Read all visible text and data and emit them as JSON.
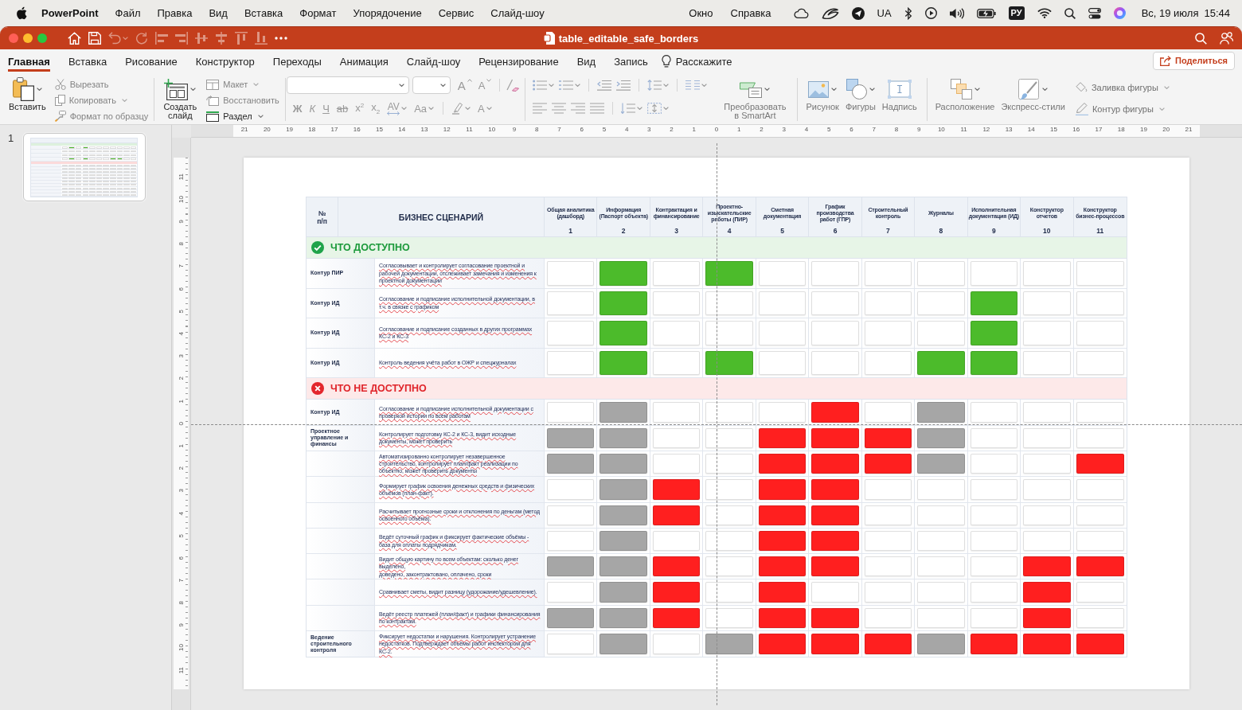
{
  "menu_bar": {
    "app": "PowerPoint",
    "menus": [
      "Файл",
      "Правка",
      "Вид",
      "Вставка",
      "Формат",
      "Упорядочение",
      "Сервис",
      "Слайд-шоу"
    ],
    "window_menus": [
      "Окно",
      "Справка"
    ],
    "region": "UA",
    "input_source": "РУ",
    "date": "Вс, 19 июля",
    "time": "15:44"
  },
  "window": {
    "title": "table_editable_safe_borders",
    "quick_access": [
      {
        "disabled": false
      },
      {
        "disabled": false
      },
      {
        "disabled": true
      },
      {
        "disabled": true
      },
      {
        "disabled": true
      },
      {
        "disabled": true
      },
      {
        "disabled": true
      },
      {
        "disabled": true
      },
      {
        "disabled": true
      },
      {
        "disabled": true
      },
      {
        "disabled": false
      }
    ]
  },
  "ribbon": {
    "tabs": [
      {
        "label": "Главная",
        "selected": true
      },
      {
        "label": "Вставка",
        "selected": false
      },
      {
        "label": "Рисование",
        "selected": false
      },
      {
        "label": "Конструктор",
        "selected": false
      },
      {
        "label": "Переходы",
        "selected": false
      },
      {
        "label": "Анимация",
        "selected": false
      },
      {
        "label": "Слайд-шоу",
        "selected": false
      },
      {
        "label": "Рецензирование",
        "selected": false
      },
      {
        "label": "Вид",
        "selected": false
      },
      {
        "label": "Запись",
        "selected": false
      }
    ],
    "tell_me": "Расскажите",
    "share": "Поделиться",
    "groups": [
      {
        "kind": "clipboard",
        "large": [
          {
            "label": "Вставить",
            "disabled": false,
            "dropdown": true
          }
        ],
        "small": [
          {
            "label": "Вырезать",
            "disabled": true,
            "dropdown": false
          },
          {
            "label": "Копировать",
            "disabled": true,
            "dropdown": true
          },
          {
            "label": "Формат по образцу",
            "disabled": true,
            "dropdown": false
          }
        ]
      },
      {
        "kind": "slides",
        "large": [
          {
            "label": "Создать слайд",
            "disabled": false,
            "dropdown": true
          }
        ],
        "small": [
          {
            "label": "Макет",
            "disabled": true,
            "dropdown": true
          },
          {
            "label": "Восстановить",
            "disabled": true,
            "dropdown": false
          },
          {
            "label": "Раздел",
            "disabled": false,
            "dropdown": true
          }
        ]
      },
      {
        "kind": "font",
        "buttons": [
          {
            "kind": "grow",
            "glyph": "A",
            "disabled": true,
            "dropdown": false
          },
          {
            "kind": "shrink",
            "glyph": "A",
            "disabled": true,
            "dropdown": false
          },
          {
            "kind": "bold",
            "glyph": "Ж",
            "disabled": true,
            "dropdown": false
          },
          {
            "kind": "italic",
            "glyph": "К",
            "disabled": true,
            "dropdown": false
          },
          {
            "kind": "underline",
            "glyph": "Ч",
            "disabled": true,
            "dropdown": false
          },
          {
            "kind": "strike",
            "glyph": "ab",
            "disabled": true,
            "dropdown": false
          },
          {
            "kind": "superscript",
            "glyph": "x$^{2}$",
            "disabled": true,
            "dropdown": false
          },
          {
            "kind": "subscript",
            "glyph": "x$_{2}$",
            "disabled": true,
            "dropdown": false
          },
          {
            "kind": "spacing",
            "glyph": "AV",
            "disabled": true,
            "dropdown": true
          },
          {
            "kind": "case",
            "glyph": "Aa",
            "disabled": true,
            "dropdown": true
          },
          {
            "kind": "color",
            "glyph": "A",
            "disabled": true,
            "dropdown": true
          }
        ]
      },
      {
        "kind": "paragraph",
        "large": [
          {
            "label": "Преобразовать в SmartArt",
            "disabled": true,
            "dropdown": true
          }
        ]
      },
      {
        "kind": "insert",
        "large": [
          {
            "label": "Рисунок",
            "disabled": true,
            "dropdown": true
          },
          {
            "label": "Фигуры",
            "disabled": true,
            "dropdown": true
          },
          {
            "label": "Надпись",
            "disabled": true,
            "dropdown": false
          }
        ]
      },
      {
        "kind": "drawing",
        "large": [
          {
            "label": "Расположение",
            "disabled": true,
            "dropdown": true
          },
          {
            "label": "Экспресс-стили",
            "disabled": true,
            "dropdown": true
          }
        ],
        "small": [
          {
            "label": "Заливка фигуры",
            "disabled": true,
            "dropdown": true
          },
          {
            "label": "Контур фигуры",
            "disabled": true,
            "dropdown": true
          }
        ]
      }
    ]
  },
  "slide_panel": {
    "slides": [
      {
        "number": "1"
      }
    ]
  },
  "rulers": {
    "horizontal": [
      "21",
      "20",
      "19",
      "18",
      "17",
      "16",
      "15",
      "14",
      "13",
      "12",
      "11",
      "10",
      "9",
      "8",
      "7",
      "6",
      "5",
      "4",
      "3",
      "2",
      "1",
      "0",
      "1",
      "2",
      "3",
      "4",
      "5",
      "6",
      "7",
      "8",
      "9",
      "10",
      "11",
      "12",
      "13",
      "14",
      "15",
      "16",
      "17",
      "18",
      "19",
      "20",
      "21"
    ],
    "vertical": [
      "11",
      "10",
      "9",
      "8",
      "7",
      "6",
      "5",
      "4",
      "3",
      "2",
      "1",
      "0",
      "1",
      "2",
      "3",
      "4",
      "5",
      "6",
      "7",
      "8",
      "9",
      "10",
      "11"
    ]
  },
  "slide": {
    "table": {
      "number_heading": "№ п/п",
      "scenario_heading": "БИЗНЕС СЦЕНАРИЙ",
      "columns": [
        {
          "title": "Общая аналитика (дашборд)",
          "number": "1"
        },
        {
          "title": "Информация (Паспорт объекта)",
          "number": "2"
        },
        {
          "title": "Контрактация и финансирование",
          "number": "3"
        },
        {
          "title": "Проектно-изыскательские работы (ПИР)",
          "number": "4"
        },
        {
          "title": "Сметная документация",
          "number": "5"
        },
        {
          "title": "График производства работ (ГПР)",
          "number": "6"
        },
        {
          "title": "Строительный контроль",
          "number": "7"
        },
        {
          "title": "Журналы",
          "number": "8"
        },
        {
          "title": "Исполнительная документация (ИД)",
          "number": "9"
        },
        {
          "title": "Конструктор отчетов",
          "number": "10"
        },
        {
          "title": "Конструктор бизнес-процессов",
          "number": "11"
        }
      ],
      "sections": [
        {
          "kind": "available",
          "title": "ЧТО ДОСТУПНО",
          "rows": [
            {
              "label": "Контур ПИР",
              "text": "Согласовывает и контролирует согласование проектной и рабочей документации, отслеживает замечания и изменения к проектной документации",
              "cells": [
                {
                  "color": "#ffffff"
                },
                {
                  "color": "#4cbb2b"
                },
                {
                  "color": "#ffffff"
                },
                {
                  "color": "#4cbb2b"
                },
                {
                  "color": "#ffffff"
                },
                {
                  "color": "#ffffff"
                },
                {
                  "color": "#ffffff"
                },
                {
                  "color": "#ffffff"
                },
                {
                  "color": "#ffffff"
                },
                {
                  "color": "#ffffff"
                },
                {
                  "color": "#ffffff"
                }
              ]
            },
            {
              "label": "Контур ИД",
              "text": "Согласование и подписание исполнительной документации, в т.ч. в связке с графиком",
              "cells": [
                {
                  "color": "#ffffff"
                },
                {
                  "color": "#4cbb2b"
                },
                {
                  "color": "#ffffff"
                },
                {
                  "color": "#ffffff"
                },
                {
                  "color": "#ffffff"
                },
                {
                  "color": "#ffffff"
                },
                {
                  "color": "#ffffff"
                },
                {
                  "color": "#ffffff"
                },
                {
                  "color": "#4cbb2b"
                },
                {
                  "color": "#ffffff"
                },
                {
                  "color": "#ffffff"
                }
              ]
            },
            {
              "label": "Контур ИД",
              "text": "Согласование и подписание созданных в других программах КС-2 и КС-3",
              "cells": [
                {
                  "color": "#ffffff"
                },
                {
                  "color": "#4cbb2b"
                },
                {
                  "color": "#ffffff"
                },
                {
                  "color": "#ffffff"
                },
                {
                  "color": "#ffffff"
                },
                {
                  "color": "#ffffff"
                },
                {
                  "color": "#ffffff"
                },
                {
                  "color": "#ffffff"
                },
                {
                  "color": "#4cbb2b"
                },
                {
                  "color": "#ffffff"
                },
                {
                  "color": "#ffffff"
                }
              ]
            },
            {
              "label": "Контур ИД",
              "text": "Контроль ведения учёта работ в ОЖР и спецжурналах",
              "cells": [
                {
                  "color": "#ffffff"
                },
                {
                  "color": "#4cbb2b"
                },
                {
                  "color": "#ffffff"
                },
                {
                  "color": "#4cbb2b"
                },
                {
                  "color": "#ffffff"
                },
                {
                  "color": "#ffffff"
                },
                {
                  "color": "#ffffff"
                },
                {
                  "color": "#4cbb2b"
                },
                {
                  "color": "#4cbb2b"
                },
                {
                  "color": "#ffffff"
                },
                {
                  "color": "#ffffff"
                }
              ]
            }
          ]
        },
        {
          "kind": "unavailable",
          "title": "ЧТО НЕ ДОСТУПНО",
          "rows": [
            {
              "label": "Контур ИД",
              "text": "Согласование и подписание исполнительной документации с проверкой истории по всем работам",
              "cells": [
                {
                  "color": "#ffffff"
                },
                {
                  "color": "#a6a6a6"
                },
                {
                  "color": "#ffffff"
                },
                {
                  "color": "#ffffff"
                },
                {
                  "color": "#ffffff"
                },
                {
                  "color": "#ff1f1f"
                },
                {
                  "color": "#ffffff"
                },
                {
                  "color": "#a6a6a6"
                },
                {
                  "color": "#ffffff"
                },
                {
                  "color": "#ffffff"
                },
                {
                  "color": "#ffffff"
                }
              ]
            },
            {
              "label": "Проектное управление и финансы",
              "text": "Контролирует подготовку КС-2 и КС-3, видит исходные документы, может проверить",
              "cells": [
                {
                  "color": "#a6a6a6"
                },
                {
                  "color": "#a6a6a6"
                },
                {
                  "color": "#ffffff"
                },
                {
                  "color": "#ffffff"
                },
                {
                  "color": "#ff1f1f"
                },
                {
                  "color": "#ff1f1f"
                },
                {
                  "color": "#ff1f1f"
                },
                {
                  "color": "#a6a6a6"
                },
                {
                  "color": "#ffffff"
                },
                {
                  "color": "#ffffff"
                },
                {
                  "color": "#ffffff"
                }
              ]
            },
            {
              "text": "Автоматизированно контролирует незавершенное строительство, контролирует план/факт реализации по объектно, может проверить документы",
              "cells": [
                {
                  "color": "#a6a6a6"
                },
                {
                  "color": "#a6a6a6"
                },
                {
                  "color": "#ffffff"
                },
                {
                  "color": "#ffffff"
                },
                {
                  "color": "#ff1f1f"
                },
                {
                  "color": "#ff1f1f"
                },
                {
                  "color": "#ff1f1f"
                },
                {
                  "color": "#a6a6a6"
                },
                {
                  "color": "#ffffff"
                },
                {
                  "color": "#ffffff"
                },
                {
                  "color": "#ff1f1f"
                }
              ]
            },
            {
              "text": "Формирует график освоения денежных средств и физических объёмов (план-факт).",
              "cells": [
                {
                  "color": "#ffffff"
                },
                {
                  "color": "#a6a6a6"
                },
                {
                  "color": "#ff1f1f"
                },
                {
                  "color": "#ffffff"
                },
                {
                  "color": "#ff1f1f"
                },
                {
                  "color": "#ff1f1f"
                },
                {
                  "color": "#ffffff"
                },
                {
                  "color": "#ffffff"
                },
                {
                  "color": "#ffffff"
                },
                {
                  "color": "#ffffff"
                },
                {
                  "color": "#ffffff"
                }
              ]
            },
            {
              "text": "Расчитывает прогнозные сроки и отклонения по деньгам (метод освоенного объёма).",
              "cells": [
                {
                  "color": "#ffffff"
                },
                {
                  "color": "#a6a6a6"
                },
                {
                  "color": "#ff1f1f"
                },
                {
                  "color": "#ffffff"
                },
                {
                  "color": "#ff1f1f"
                },
                {
                  "color": "#ff1f1f"
                },
                {
                  "color": "#ffffff"
                },
                {
                  "color": "#ffffff"
                },
                {
                  "color": "#ffffff"
                },
                {
                  "color": "#ffffff"
                },
                {
                  "color": "#ffffff"
                }
              ]
            },
            {
              "text": "Ведёт суточный график и фиксирует фактические объёмы - база для оплаты подрядчикам.",
              "cells": [
                {
                  "color": "#ffffff"
                },
                {
                  "color": "#a6a6a6"
                },
                {
                  "color": "#ffffff"
                },
                {
                  "color": "#ffffff"
                },
                {
                  "color": "#ff1f1f"
                },
                {
                  "color": "#ff1f1f"
                },
                {
                  "color": "#ffffff"
                },
                {
                  "color": "#ffffff"
                },
                {
                  "color": "#ffffff"
                },
                {
                  "color": "#ffffff"
                },
                {
                  "color": "#ffffff"
                }
              ]
            },
            {
              "text": "Видит общую картину по всем объектам: сколько денег выделено,\nдоведено, законтрактовано, оплачено, сроки",
              "cells": [
                {
                  "color": "#a6a6a6"
                },
                {
                  "color": "#a6a6a6"
                },
                {
                  "color": "#ff1f1f"
                },
                {
                  "color": "#ffffff"
                },
                {
                  "color": "#ff1f1f"
                },
                {
                  "color": "#ff1f1f"
                },
                {
                  "color": "#ffffff"
                },
                {
                  "color": "#ffffff"
                },
                {
                  "color": "#ffffff"
                },
                {
                  "color": "#ff1f1f"
                },
                {
                  "color": "#ff1f1f"
                }
              ]
            },
            {
              "text": "Сравнивает сметы, видит разницу (удорожание/удешевление).",
              "cells": [
                {
                  "color": "#ffffff"
                },
                {
                  "color": "#a6a6a6"
                },
                {
                  "color": "#ff1f1f"
                },
                {
                  "color": "#ffffff"
                },
                {
                  "color": "#ff1f1f"
                },
                {
                  "color": "#ffffff"
                },
                {
                  "color": "#ffffff"
                },
                {
                  "color": "#ffffff"
                },
                {
                  "color": "#ffffff"
                },
                {
                  "color": "#ff1f1f"
                },
                {
                  "color": "#ffffff"
                }
              ]
            },
            {
              "text": "Ведёт реестр платежей (план/факт) и графики финансирования\nпо контрактам.",
              "cells": [
                {
                  "color": "#a6a6a6"
                },
                {
                  "color": "#a6a6a6"
                },
                {
                  "color": "#ff1f1f"
                },
                {
                  "color": "#ffffff"
                },
                {
                  "color": "#ff1f1f"
                },
                {
                  "color": "#ff1f1f"
                },
                {
                  "color": "#ffffff"
                },
                {
                  "color": "#ffffff"
                },
                {
                  "color": "#ffffff"
                },
                {
                  "color": "#ff1f1f"
                },
                {
                  "color": "#ffffff"
                }
              ]
            },
            {
              "label": "Ведение строительного контроля",
              "text": "Фиксирует недостатки и нарушения. Контролирует устранение недостатков. Подтверждает объёмы работ инспектором для КС-2.",
              "cells": [
                {
                  "color": "#ffffff"
                },
                {
                  "color": "#a6a6a6"
                },
                {
                  "color": "#ffffff"
                },
                {
                  "color": "#a6a6a6"
                },
                {
                  "color": "#ff1f1f"
                },
                {
                  "color": "#ff1f1f"
                },
                {
                  "color": "#ff1f1f"
                },
                {
                  "color": "#a6a6a6"
                },
                {
                  "color": "#ff1f1f"
                },
                {
                  "color": "#ff1f1f"
                },
                {
                  "color": "#ff1f1f"
                }
              ]
            }
          ]
        }
      ]
    }
  }
}
